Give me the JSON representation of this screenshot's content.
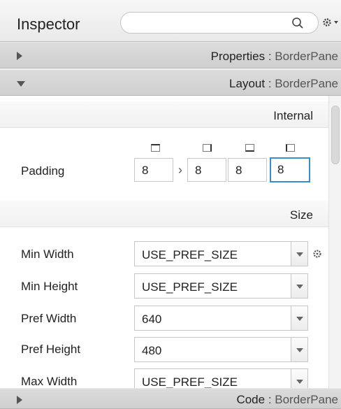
{
  "header": {
    "title": "Inspector",
    "search_value": ""
  },
  "sections": {
    "properties": {
      "name": "Properties",
      "separator": " : ",
      "type": "BorderPane"
    },
    "layout": {
      "name": "Layout",
      "separator": " : ",
      "type": "BorderPane"
    },
    "code": {
      "name": "Code",
      "separator": " : ",
      "type": "BorderPane"
    }
  },
  "layout": {
    "internal_heading": "Internal",
    "size_heading": "Size",
    "padding": {
      "label": "Padding",
      "top": "8",
      "right": "8",
      "bottom": "8",
      "left": "8"
    },
    "min_width": {
      "label": "Min Width",
      "value": "USE_PREF_SIZE"
    },
    "min_height": {
      "label": "Min Height",
      "value": "USE_PREF_SIZE"
    },
    "pref_width": {
      "label": "Pref Width",
      "value": "640"
    },
    "pref_height": {
      "label": "Pref Height",
      "value": "480"
    },
    "max_width": {
      "label": "Max Width",
      "value": "USE_PREF_SIZE"
    }
  },
  "colors": {
    "focus": "#3a8ec6",
    "section_bar": "#d4d4d4"
  }
}
